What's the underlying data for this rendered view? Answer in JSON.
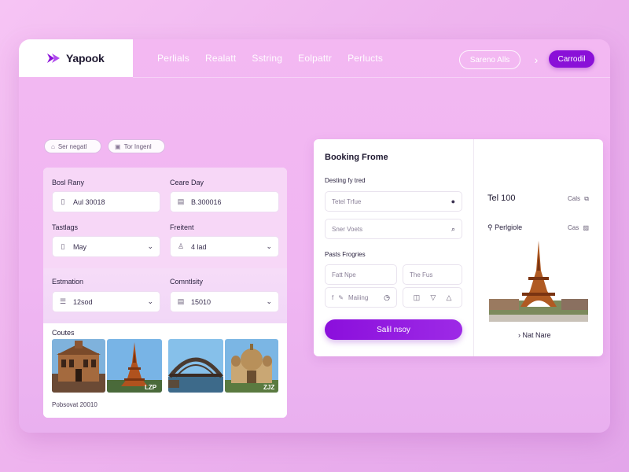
{
  "colors": {
    "accent": "#8a10d8",
    "background": "#f0b6f2",
    "panel": "#ffffff"
  },
  "header": {
    "logo_text": "Yapook",
    "nav": [
      "Perlials",
      "Realatt",
      "Sstring",
      "Eolpattr",
      "Perlucts"
    ],
    "search_label": "Sareno Alls",
    "cta_label": "Carrodil"
  },
  "chips": [
    {
      "icon": "home-icon",
      "label": "Ser negatl"
    },
    {
      "icon": "calendar-icon",
      "label": "Tor Ingenl"
    }
  ],
  "form": {
    "field1": {
      "label": "Bosl Rany",
      "value": "Aul 30018"
    },
    "field2": {
      "label": "Ceare Day",
      "value": "B.300016"
    },
    "field3": {
      "label": "Tastlags",
      "value": "May"
    },
    "field4": {
      "label": "Freitent",
      "value": "4 lad"
    },
    "field5": {
      "label": "Estmation",
      "value": "12sod"
    },
    "field6": {
      "label": "Comntlsity",
      "value": "15010"
    }
  },
  "gallery": {
    "label": "Coutes",
    "caption": "Pobsovat 20010"
  },
  "booking": {
    "title": "Booking Frome",
    "subtitle1": "Desting fy tred",
    "input1_placeholder": "Tetel Trfue",
    "input2_placeholder": "Sner Voets",
    "subtitle2": "Pasts Frogries",
    "input3_placeholder": "Fatt Npe",
    "input4_placeholder": "The Fus",
    "input5_placeholder": "Maiiing",
    "submit_label": "Salil nsoy",
    "tel": "Tel 100",
    "tag1": "Cals",
    "location": "Perlgiole",
    "tag2": "Cas",
    "more_label": "Nat Nare"
  }
}
